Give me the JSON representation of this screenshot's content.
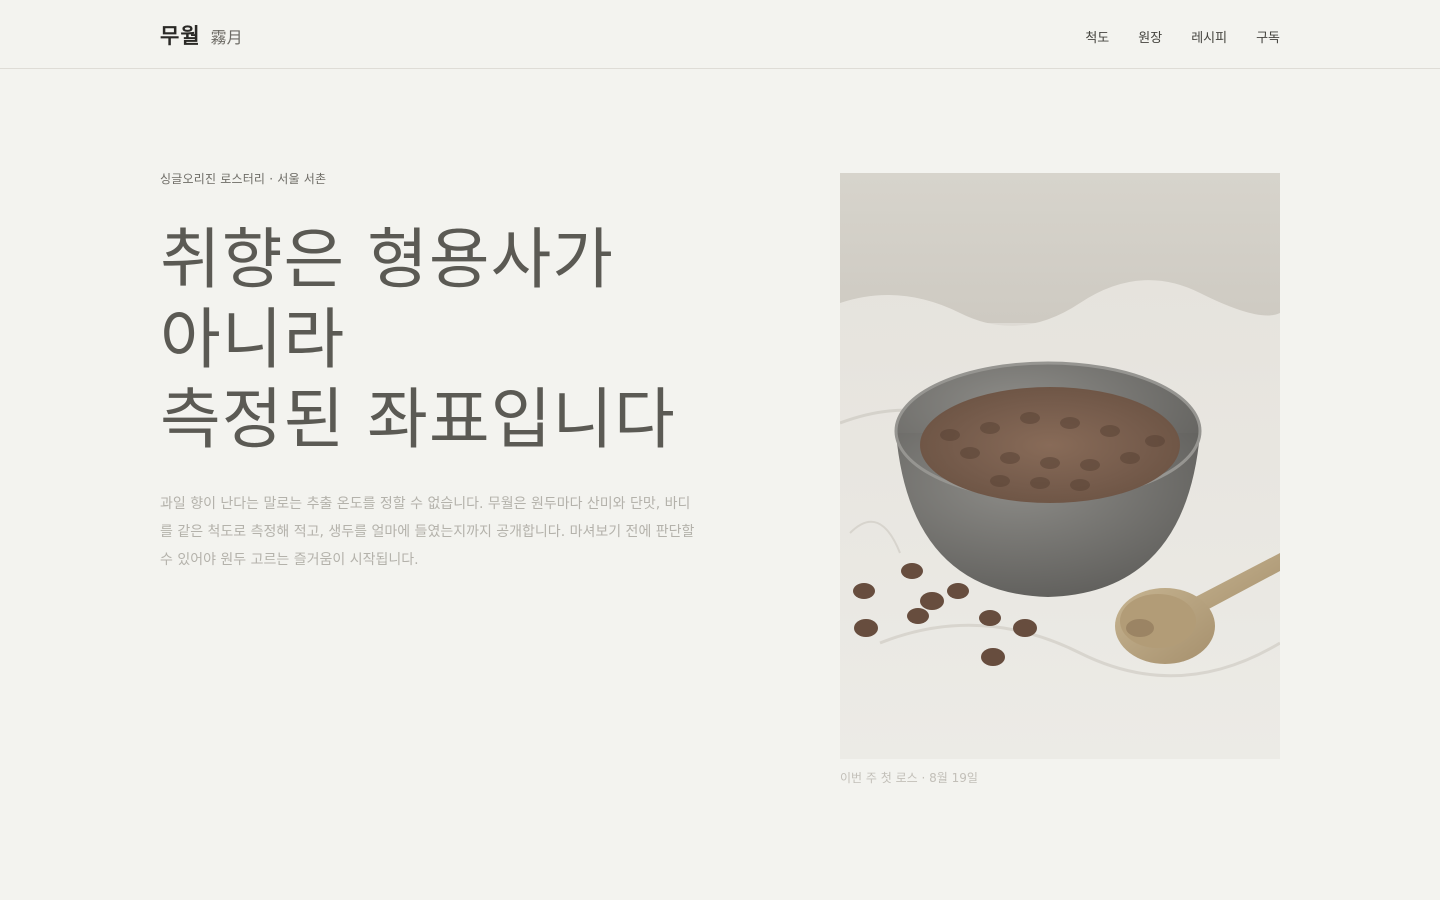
{
  "brand": {
    "name": "무월",
    "hanja": "霧月"
  },
  "nav": {
    "items": [
      {
        "label": "척도"
      },
      {
        "label": "원장"
      },
      {
        "label": "레시피"
      },
      {
        "label": "구독"
      }
    ]
  },
  "hero": {
    "eyebrow": "싱글오리진 로스터리 · 서울 서촌",
    "headline": {
      "line1": "취향은 형용사가",
      "line2": "아니라",
      "line3": "측정된 좌표입니다"
    },
    "lede": "과일 향이 난다는 말로는 추출 온도를 정할 수 없습니다. 무월은 원두마다 산미와 단맛, 바디를 같은 척도로 측정해 적고, 생두를 얼마에 들였는지까지 공개합니다. 마셔보기 전에 판단할 수 있어야 원두 고르는 즐거움이 시작됩니다."
  },
  "figure": {
    "caption": "이번 주 첫 로스 · 8월 19일"
  }
}
